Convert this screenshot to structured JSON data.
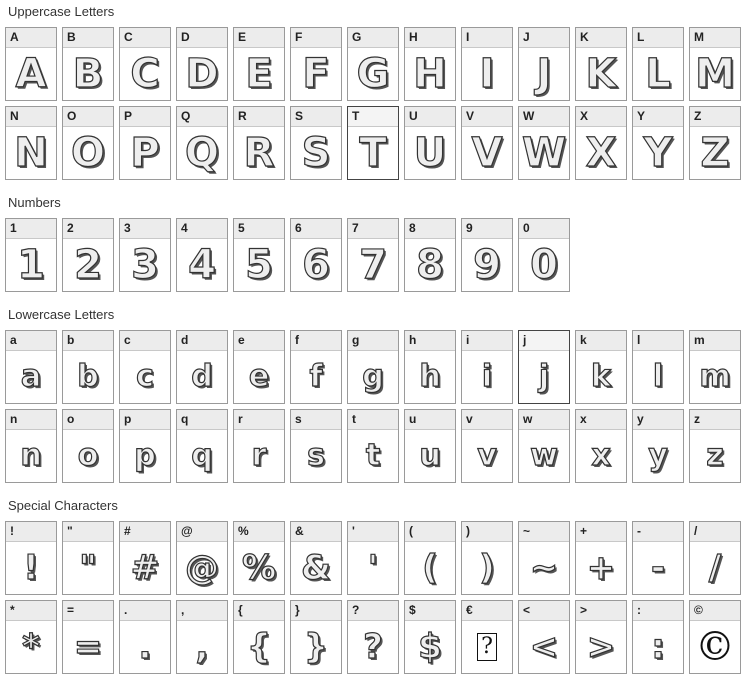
{
  "sections": {
    "uppercase": {
      "title": "Uppercase Letters",
      "chars": [
        "A",
        "B",
        "C",
        "D",
        "E",
        "F",
        "G",
        "H",
        "I",
        "J",
        "K",
        "L",
        "M",
        "N",
        "O",
        "P",
        "Q",
        "R",
        "S",
        "T",
        "U",
        "V",
        "W",
        "X",
        "Y",
        "Z"
      ]
    },
    "numbers": {
      "title": "Numbers",
      "chars": [
        "1",
        "2",
        "3",
        "4",
        "5",
        "6",
        "7",
        "8",
        "9",
        "0"
      ]
    },
    "lowercase": {
      "title": "Lowercase Letters",
      "chars": [
        "a",
        "b",
        "c",
        "d",
        "e",
        "f",
        "g",
        "h",
        "i",
        "j",
        "k",
        "l",
        "m",
        "n",
        "o",
        "p",
        "q",
        "r",
        "s",
        "t",
        "u",
        "v",
        "w",
        "x",
        "y",
        "z"
      ]
    },
    "special": {
      "title": "Special Characters",
      "chars": [
        "!",
        "\"",
        "#",
        "@",
        "%",
        "&",
        "'",
        "(",
        ")",
        "~",
        "+",
        "-",
        "/",
        "*",
        "=",
        ".",
        ",",
        "{",
        "}",
        "?",
        "$",
        "€",
        "<",
        ">",
        ":",
        "©"
      ]
    }
  },
  "glyph_overrides": {
    "€": "?",
    "©": "©"
  }
}
